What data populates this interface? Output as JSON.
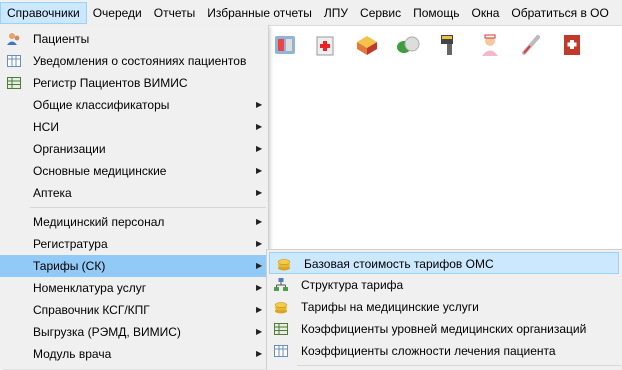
{
  "menubar": {
    "items": [
      "Справочники",
      "Очереди",
      "Отчеты",
      "Избранные отчеты",
      "ЛПУ",
      "Сервис",
      "Помощь",
      "Окна",
      "Обратиться в ОО"
    ]
  },
  "toolbar": {
    "icons": [
      "pharmacy-cabinet-icon",
      "medical-box-icon",
      "pill-box-icon",
      "pills-icon",
      "barcode-scanner-icon",
      "nurse-icon",
      "thermometer-icon",
      "medical-book-icon"
    ]
  },
  "main_menu": {
    "items": [
      {
        "label": "Пациенты",
        "icon": "patients-icon"
      },
      {
        "label": "Уведомления о состояниях пациентов",
        "icon": "grid-icon"
      },
      {
        "label": "Регистр Пациентов ВИМИС",
        "icon": "table-icon"
      },
      {
        "label": "Общие классификаторы"
      },
      {
        "label": "НСИ"
      },
      {
        "label": "Организации"
      },
      {
        "label": "Основные медицинские"
      },
      {
        "label": "Аптека"
      },
      {
        "label": "Медицинский персонал"
      },
      {
        "label": "Регистратура"
      },
      {
        "label": "Тарифы (СК)"
      },
      {
        "label": "Номенклатура услуг"
      },
      {
        "label": "Справочник КСГ/КПГ"
      },
      {
        "label": "Выгрузка (РЭМД, ВИМИС)"
      },
      {
        "label": "Модуль врача"
      }
    ]
  },
  "submenu": {
    "items": [
      {
        "label": "Базовая стоимость тарифов ОМС",
        "icon": "coins-icon"
      },
      {
        "label": "Структура тарифа",
        "icon": "hierarchy-icon"
      },
      {
        "label": "Тарифы на медицинские услуги",
        "icon": "coins-icon"
      },
      {
        "label": "Коэффициенты уровней медицинских организаций",
        "icon": "table-icon"
      },
      {
        "label": "Коэффициенты сложности лечения пациента",
        "icon": "grid-icon"
      }
    ]
  },
  "colors": {
    "highlight": "#91c9f7",
    "hover": "#cce8ff",
    "menu_bg": "#f0f0f0"
  }
}
